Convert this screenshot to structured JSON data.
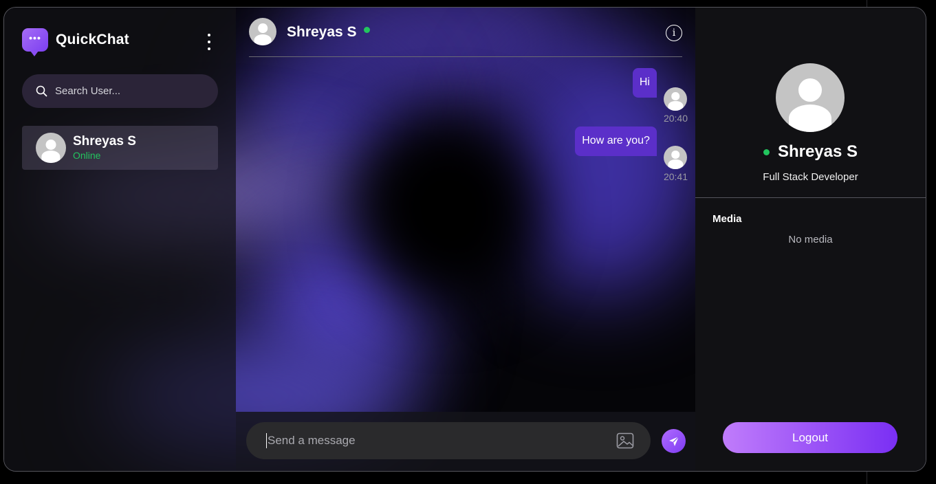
{
  "app": {
    "name": "QuickChat",
    "logo_icon": "chat-bubble-dots-icon",
    "accent_color": "#7c3ff0"
  },
  "sidebar": {
    "search": {
      "placeholder": "Search User...",
      "value": ""
    },
    "contacts": [
      {
        "name": "Shreyas S",
        "status": "Online",
        "selected": true
      }
    ]
  },
  "chat": {
    "header": {
      "name": "Shreyas S",
      "online": true
    },
    "messages": [
      {
        "text": "Hi",
        "time": "20:40",
        "outgoing": true
      },
      {
        "text": "How are you?",
        "time": "20:41",
        "outgoing": true
      }
    ],
    "composer": {
      "placeholder": "Send a message",
      "value": ""
    }
  },
  "profile": {
    "name": "Shreyas S",
    "bio": "Full Stack Developer",
    "media_label": "Media",
    "media_empty": "No media",
    "logout_label": "Logout"
  },
  "colors": {
    "online": "#22c55e",
    "bubble": "#5b2fc9",
    "logout_start": "#c07cfb",
    "logout_end": "#7a2ff3"
  }
}
